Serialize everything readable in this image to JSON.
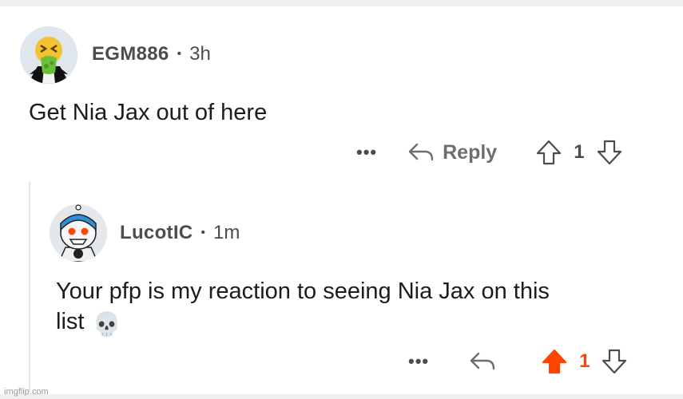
{
  "comments": [
    {
      "username": "EGM886",
      "separator": "•",
      "time": "3h",
      "text": "Get Nia Jax out of here",
      "more_label": "•••",
      "reply_label": "Reply",
      "vote_count": "1",
      "upvoted": false
    },
    {
      "username": "LucotIC",
      "separator": "•",
      "time": "1m",
      "text_line1": "Your pfp is my reaction to seeing Nia Jax on this",
      "text_line2": "list",
      "emoji": "💀",
      "more_label": "•••",
      "vote_count": "1",
      "upvoted": true
    }
  ],
  "colors": {
    "upvote_active": "#ff4500",
    "muted_icon": "#6b6e72",
    "thread_line": "#e3e3e3"
  },
  "icons": {
    "reply": "reply-arrow-icon",
    "upvote": "upvote-arrow-icon",
    "downvote": "downvote-arrow-icon"
  },
  "watermark": "imgflip.com"
}
